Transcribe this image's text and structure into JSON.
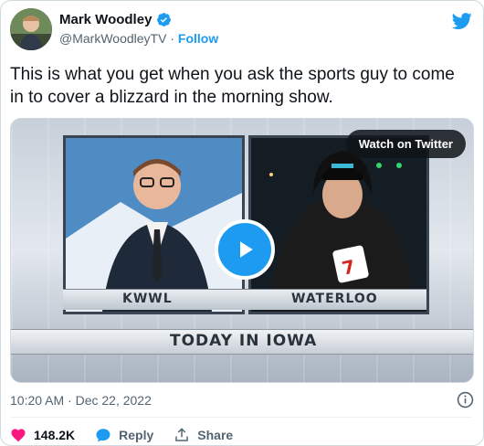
{
  "author": {
    "name": "Mark Woodley",
    "handle": "@MarkWoodleyTV",
    "separator": "·",
    "follow_label": "Follow"
  },
  "tweet": {
    "text": "This is what you get when you ask the sports guy to come in to cover a blizzard in the morning show.",
    "timestamp": "10:20 AM · Dec 22, 2022"
  },
  "media": {
    "watch_label": "Watch on Twitter",
    "left_label": "KWWL",
    "right_label": "WATERLOO",
    "banner": "TODAY IN IOWA"
  },
  "actions": {
    "likes": "148.2K",
    "reply_label": "Reply",
    "share_label": "Share"
  },
  "colors": {
    "accent": "#1d9bf0",
    "like": "#f91880",
    "secondary_text": "#536471"
  },
  "icons": [
    "avatar",
    "verified-badge-icon",
    "twitter-bird-icon",
    "play-icon",
    "info-icon",
    "heart-icon",
    "reply-bubble-icon",
    "share-icon"
  ]
}
